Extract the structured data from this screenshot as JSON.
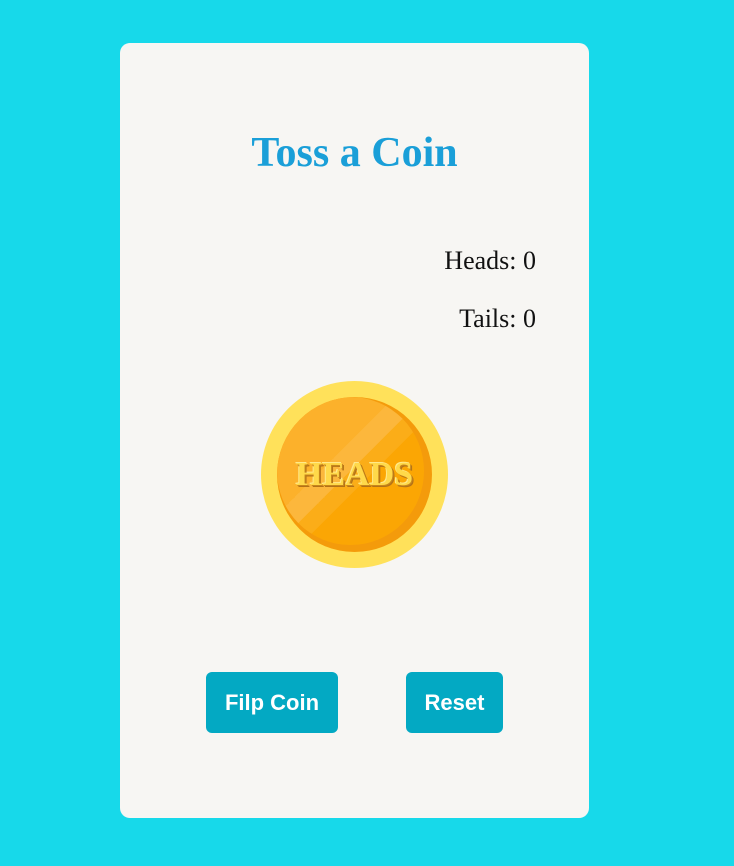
{
  "app": {
    "title": "Toss a Coin"
  },
  "scores": {
    "heads_label": "Heads: 0",
    "tails_label": "Tails: 0"
  },
  "coin": {
    "face_text": "HEADS"
  },
  "buttons": {
    "flip_label": "Filp Coin",
    "reset_label": "Reset"
  },
  "colors": {
    "background": "#17d9ea",
    "card": "#f7f6f3",
    "title": "#1a9fd8",
    "button": "#03a9c3",
    "coin_rim": "#ffe15a",
    "coin_face": "#fcb12b"
  }
}
